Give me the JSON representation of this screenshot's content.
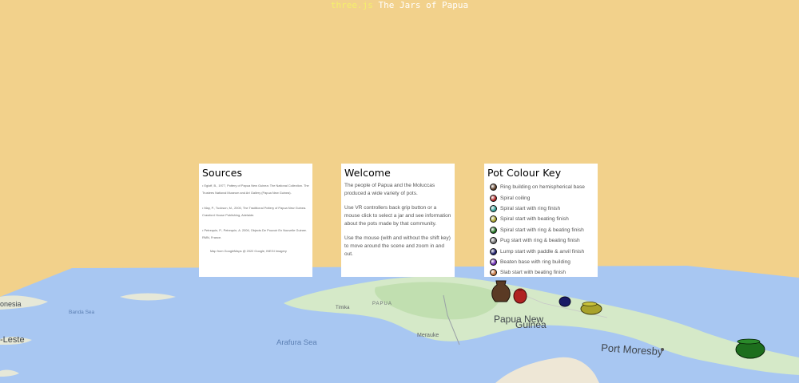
{
  "header": {
    "lib": "three.js",
    "title": "The Jars of Papua"
  },
  "map_labels": {
    "png_line1": "Papua New",
    "png_line2": "Guinea",
    "port_moresby": "Port Moresby",
    "arafura_sea": "Arafura Sea",
    "merauke": "Merauke",
    "timika": "Timika",
    "papua": "PAPUA",
    "leste": "-Leste",
    "donesia": "onesia",
    "banda_sea": "Banda Sea"
  },
  "sources": {
    "title": "Sources",
    "items": [
      "• Egloff, B., 1977, Pottery of Papua New Guinea: The National Collection. The Trustees National Museum and Art Gallery (Papua New Guinea).",
      "• May, P., Tuckson, M., 2000, The Traditional Pottery of Papua New Guinea. Crawford House Publishing, Adelaide.",
      "• Petrequin, P., Petrequin, A. 2006, Objects De Pouvoir En Nouvelle Guinee. RMN, France."
    ],
    "map_credit": "Map from GoogleMaps @ 2022 Google, INEGI Imagery"
  },
  "welcome": {
    "title": "Welcome",
    "paragraphs": [
      "The people of Papua and the Moluccas produced a wide variety of pots.",
      "Use VR controllers back grip button or a mouse click to select a jar and see information about the pots made by that community.",
      "Use the mouse (with and without the shift key) to move around the scene and zoom in and out."
    ]
  },
  "colour_key": {
    "title": "Pot Colour Key",
    "items": [
      {
        "label": "Ring building on hemispherical base",
        "color": "#5a3a24"
      },
      {
        "label": "Spiral coiling",
        "color": "#b02222"
      },
      {
        "label": "Spiral start with ring finish",
        "color": "#2f9f96"
      },
      {
        "label": "Spiral start with beating finish",
        "color": "#a8a22a"
      },
      {
        "label": "Spiral start with ring & beating finish",
        "color": "#1d6e1d"
      },
      {
        "label": "Pug start with ring & beating finish",
        "color": "#6e6e6e"
      },
      {
        "label": "Lump start with paddle & anvil finish",
        "color": "#1a1a66"
      },
      {
        "label": "Beaten base with ring building",
        "color": "#6a2ab0"
      },
      {
        "label": "Slab start with beating finish",
        "color": "#c0703a"
      }
    ]
  },
  "pots": [
    {
      "name": "brown-jar",
      "color": "#5a3a24"
    },
    {
      "name": "red-jar",
      "color": "#b02222"
    },
    {
      "name": "navy-jar",
      "color": "#1a1a66"
    },
    {
      "name": "olive-bowl",
      "color": "#a8a22a"
    },
    {
      "name": "green-bowl",
      "color": "#1d6e1d"
    }
  ]
}
